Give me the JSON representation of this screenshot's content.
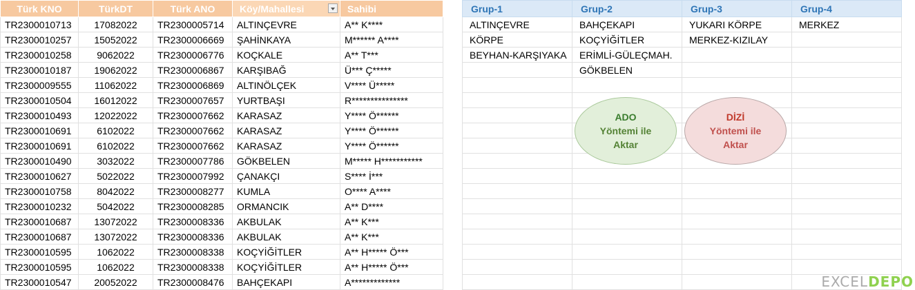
{
  "main_table": {
    "headers": [
      "Türk KNO",
      "TürkDT",
      "Türk ANO",
      "Köy/Mahallesi",
      "Sahibi"
    ],
    "rows": [
      [
        "TR2300010713",
        "17082022",
        "TR2300005714",
        "ALTINÇEVRE",
        "A** K****"
      ],
      [
        "TR2300010257",
        "15052022",
        "TR2300006669",
        "ŞAHİNKAYA",
        "M****** A****"
      ],
      [
        "TR2300010258",
        "9062022",
        "TR2300006776",
        "KOÇKALE",
        "A** T***"
      ],
      [
        "TR2300010187",
        "19062022",
        "TR2300006867",
        "KARŞIBAĞ",
        "Ü*** Ç*****"
      ],
      [
        "TR2300009555",
        "11062022",
        "TR2300006869",
        "ALTINÖLÇEK",
        "V**** Ü*****"
      ],
      [
        "TR2300010504",
        "16012022",
        "TR2300007657",
        "YURTBAŞI",
        "R***************"
      ],
      [
        "TR2300010493",
        "12022022",
        "TR2300007662",
        "KARASAZ",
        "Y**** Ö******"
      ],
      [
        "TR2300010691",
        "6102022",
        "TR2300007662",
        "KARASAZ",
        "Y**** Ö******"
      ],
      [
        "TR2300010691",
        "6102022",
        "TR2300007662",
        "KARASAZ",
        "Y**** Ö******"
      ],
      [
        "TR2300010490",
        "3032022",
        "TR2300007786",
        "GÖKBELEN",
        "M***** H***********"
      ],
      [
        "TR2300010627",
        "5022022",
        "TR2300007992",
        "ÇANAKÇI",
        "S**** İ***"
      ],
      [
        "TR2300010758",
        "8042022",
        "TR2300008277",
        "KUMLA",
        "O**** A****"
      ],
      [
        "TR2300010232",
        "5042022",
        "TR2300008285",
        "ORMANCIK",
        "A** D****"
      ],
      [
        "TR2300010687",
        "13072022",
        "TR2300008336",
        "AKBULAK",
        "A** K***"
      ],
      [
        "TR2300010687",
        "13072022",
        "TR2300008336",
        "AKBULAK",
        "A** K***"
      ],
      [
        "TR2300010595",
        "1062022",
        "TR2300008338",
        "KOÇYİĞİTLER",
        "A** H***** Ö***"
      ],
      [
        "TR2300010595",
        "1062022",
        "TR2300008338",
        "KOÇYİĞİTLER",
        "A** H***** Ö***"
      ],
      [
        "TR2300010547",
        "20052022",
        "TR2300008476",
        "BAHÇEKAPI",
        "A*************"
      ]
    ]
  },
  "grup_table": {
    "headers": [
      "Grup-1",
      "Grup-2",
      "Grup-3",
      "Grup-4"
    ],
    "rows": [
      [
        "ALTINÇEVRE",
        "BAHÇEKAPI",
        "YUKARI KÖRPE",
        "MERKEZ"
      ],
      [
        "KÖRPE",
        "KOÇYİĞİTLER",
        "MERKEZ-KIZILAY",
        ""
      ],
      [
        "BEYHAN-KARŞIYAKA",
        "ERİMLİ-GÜLEÇMAH.",
        "",
        ""
      ],
      [
        "",
        "GÖKBELEN",
        "",
        ""
      ]
    ],
    "empty_rows": 14
  },
  "buttons": {
    "ado": [
      "ADO",
      "Yöntemi ile",
      "Aktar"
    ],
    "dizi": [
      "DİZİ",
      "Yöntemi ile",
      "Aktar"
    ]
  },
  "watermark": {
    "prefix": "EXCEL",
    "suffix": "DEPO"
  },
  "colors": {
    "main_header_bg": "#f7c9a0",
    "grup_header_bg": "#dbe9f7",
    "grup_header_text": "#2e75b6",
    "ado_fill": "#e2efda",
    "dizi_fill": "#f4dcdc"
  }
}
